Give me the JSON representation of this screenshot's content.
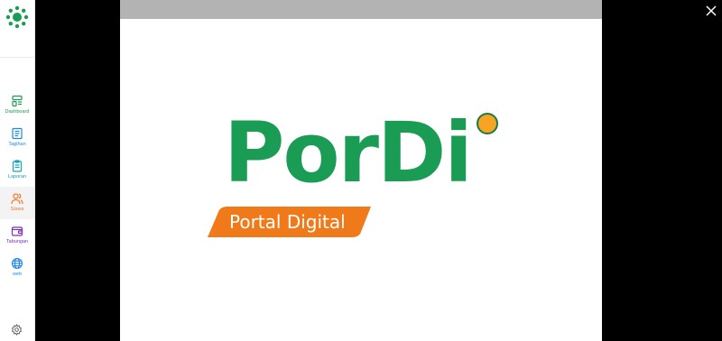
{
  "sidebar": {
    "items": [
      {
        "label": "Dashboard",
        "icon": "dashboard-icon",
        "color": "#1a9c55",
        "active": false
      },
      {
        "label": "Tagihan",
        "icon": "bill-icon",
        "color": "#1e88e5",
        "active": false
      },
      {
        "label": "Laporan",
        "icon": "report-icon",
        "color": "#1aa3b8",
        "active": false
      },
      {
        "label": "Siswa",
        "icon": "users-icon",
        "color": "#f07a2a",
        "active": true
      },
      {
        "label": "Tabungan",
        "icon": "wallet-icon",
        "color": "#7b2fbe",
        "active": false
      },
      {
        "label": "web",
        "icon": "globe-icon",
        "color": "#1e88e5",
        "active": false
      }
    ]
  },
  "document": {
    "brand_name": "PorDi",
    "brand_tagline": "Portal Digital",
    "brand_color": "#1a9c55",
    "banner_color": "#f07a1a"
  }
}
